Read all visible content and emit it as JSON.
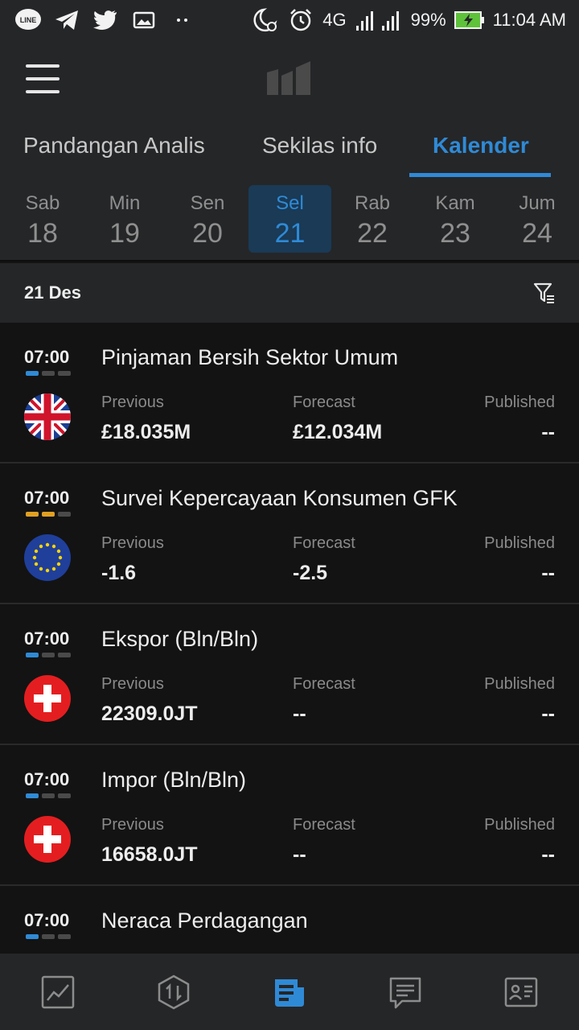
{
  "status_bar": {
    "network": "4G",
    "sim1": "1",
    "sim2": "2",
    "battery": "99%",
    "time": "11:04 AM",
    "icons": [
      "line-icon",
      "telegram-icon",
      "twitter-icon",
      "image-icon",
      "more-dots-icon",
      "dnd-moon-icon",
      "alarm-icon",
      "signal-icon",
      "battery-charging-icon"
    ]
  },
  "header": {
    "menu_icon": "hamburger-menu-icon",
    "logo_icon": "app-logo-icon"
  },
  "tabs": [
    {
      "label": "Pandangan Analis"
    },
    {
      "label": "Sekilas info"
    },
    {
      "label": "Kalender",
      "active": true
    }
  ],
  "days": [
    {
      "name": "Sab",
      "num": "18"
    },
    {
      "name": "Min",
      "num": "19"
    },
    {
      "name": "Sen",
      "num": "20"
    },
    {
      "name": "Sel",
      "num": "21",
      "active": true
    },
    {
      "name": "Rab",
      "num": "22"
    },
    {
      "name": "Kam",
      "num": "23"
    },
    {
      "name": "Jum",
      "num": "24"
    }
  ],
  "date_bar": {
    "label": "21 Des",
    "filter_icon": "filter-icon"
  },
  "labels": {
    "previous": "Previous",
    "forecast": "Forecast",
    "published": "Published"
  },
  "events": [
    {
      "time": "07:00",
      "importance": 1,
      "importance_color": "#2f8ad6",
      "title": "Pinjaman Bersih Sektor Umum",
      "flag": "uk-flag-icon",
      "previous": "£18.035M",
      "forecast": "£12.034M",
      "published": "--"
    },
    {
      "time": "07:00",
      "importance": 2,
      "importance_color": "#e0a022",
      "title": "Survei Kepercayaan Konsumen GFK",
      "flag": "eu-flag-icon",
      "previous": "-1.6",
      "forecast": "-2.5",
      "published": "--"
    },
    {
      "time": "07:00",
      "importance": 1,
      "importance_color": "#2f8ad6",
      "title": "Ekspor (Bln/Bln)",
      "flag": "swiss-flag-icon",
      "previous": "22309.0JT",
      "forecast": "--",
      "published": "--"
    },
    {
      "time": "07:00",
      "importance": 1,
      "importance_color": "#2f8ad6",
      "title": "Impor (Bln/Bln)",
      "flag": "swiss-flag-icon",
      "previous": "16658.0JT",
      "forecast": "--",
      "published": "--"
    },
    {
      "time": "07:00",
      "importance": 1,
      "importance_color": "#2f8ad6",
      "title": "Neraca Perdagangan",
      "flag": "swiss-flag-icon",
      "previous": "",
      "forecast": "",
      "published": ""
    }
  ],
  "bottom_nav": [
    {
      "icon": "chart-icon"
    },
    {
      "icon": "trade-icon"
    },
    {
      "icon": "news-icon",
      "active": true
    },
    {
      "icon": "message-icon"
    },
    {
      "icon": "profile-icon"
    }
  ],
  "colors": {
    "accent": "#2f8ad6",
    "background": "#131313",
    "panel": "#252628",
    "importance_orange": "#e0a022"
  }
}
